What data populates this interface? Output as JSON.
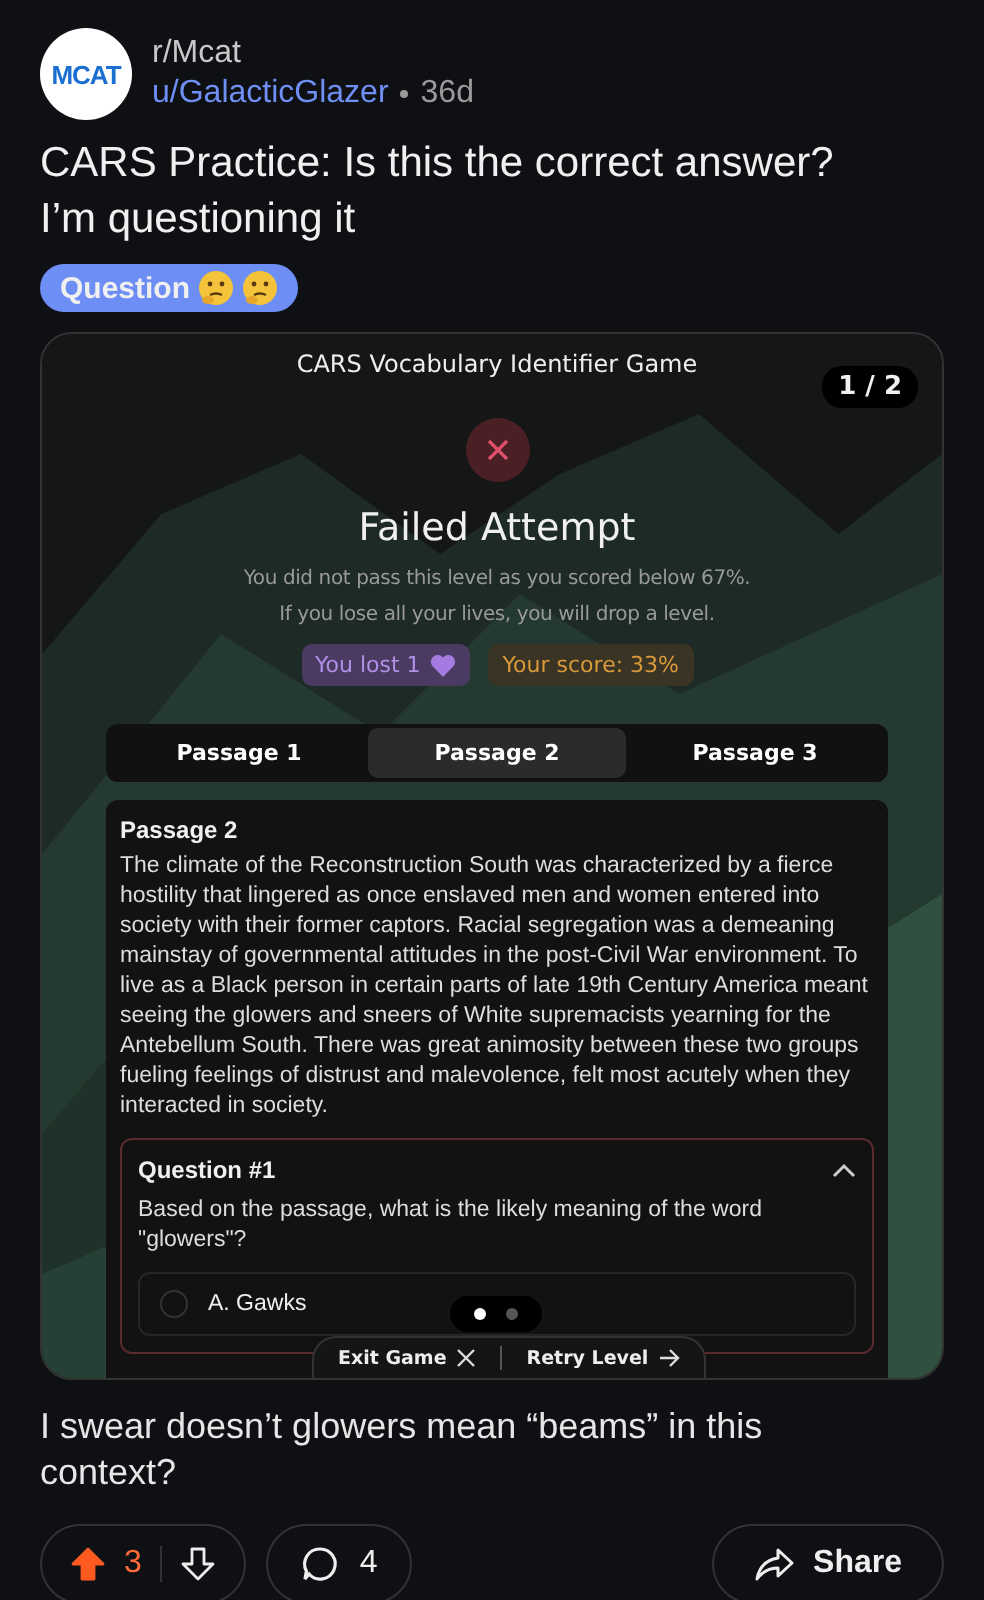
{
  "post": {
    "avatar_text": "MCAT",
    "subreddit": "r/Mcat",
    "author": "u/GalacticGlazer",
    "age": "36d",
    "title": "CARS Practice: Is this the correct answer? I’m questioning it",
    "flair": "Question",
    "flair_emojis": [
      {
        "kind": "thinking"
      },
      {
        "kind": "thinking"
      }
    ],
    "body": "I swear doesn’t glowers mean “beams” in this context?"
  },
  "game": {
    "title": "CARS Vocabulary Identifier Game",
    "page": "1 / 2",
    "result_title": "Failed Attempt",
    "messages": [
      "You did not pass this level as you scored below 67%.",
      "If you lose all your lives, you will drop a level."
    ],
    "badges": [
      {
        "kind": "lives",
        "text": "You lost 1"
      },
      {
        "kind": "score",
        "text": "Your score: 33%"
      }
    ],
    "tabs": [
      {
        "label": "Passage 1",
        "selected": false
      },
      {
        "label": "Passage 2",
        "selected": true
      },
      {
        "label": "Passage 3",
        "selected": false
      }
    ],
    "passage": {
      "heading": "Passage 2",
      "text": "The climate of the Reconstruction South was characterized by a fierce hostility that lingered as once enslaved men and women entered into society with their former captors. Racial segregation was a demeaning mainstay of governmental attitudes in the post-Civil War environment. To live as a Black person in certain parts of late 19th Century America meant seeing the glowers and sneers of White supremacists yearning for the Antebellum South. There was great animosity between these two groups fueling feelings of distrust and malevolence, felt most acutely when they interacted in society."
    },
    "question": {
      "heading": "Question #1",
      "expanded": true,
      "prompt": "Based on the passage, what is the likely meaning of the word \"glowers\"?",
      "options": [
        {
          "label": "A. Gawks",
          "selected": false
        }
      ]
    },
    "pager": [
      {
        "selected": true
      },
      {
        "selected": false
      }
    ],
    "actions": [
      "Exit Game",
      "Retry Level"
    ]
  },
  "footer": {
    "votes": "3",
    "upvoted": true,
    "comments": "4",
    "share": "Share"
  }
}
